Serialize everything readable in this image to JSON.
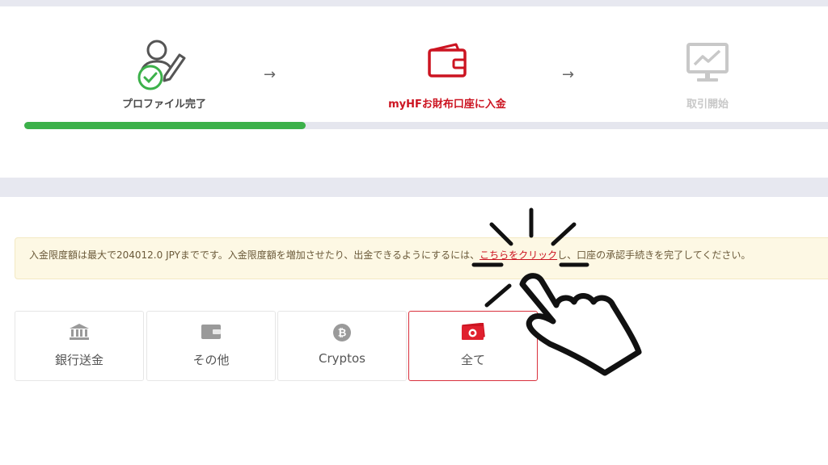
{
  "steps": [
    {
      "label": "プロファイル完了",
      "status": "complete",
      "icon": "user-edit-check-icon"
    },
    {
      "label": "myHFお財布口座に入金",
      "status": "active",
      "icon": "wallet-icon"
    },
    {
      "label": "取引開始",
      "status": "inactive",
      "icon": "monitor-chart-icon"
    }
  ],
  "progress": {
    "value": 0.35
  },
  "notice": {
    "text_before": "入金限度額は最大で204012.0 JPYまでです。入金限度額を増加させたり、出金できるようにするには、",
    "link": "こちらをクリック",
    "text_after": "し、口座の承認手続きを完了してください。"
  },
  "methods": [
    {
      "label": "銀行送金",
      "icon": "bank-icon"
    },
    {
      "label": "その他",
      "icon": "wallet-icon"
    },
    {
      "label": "Cryptos",
      "icon": "bitcoin-icon"
    },
    {
      "label": "全て",
      "icon": "money-icon",
      "selected": true
    }
  ],
  "colors": {
    "accent": "#cc1421",
    "progress": "#3cb14a",
    "complete": "#3cb14a",
    "inactive": "#c8c8c8"
  }
}
